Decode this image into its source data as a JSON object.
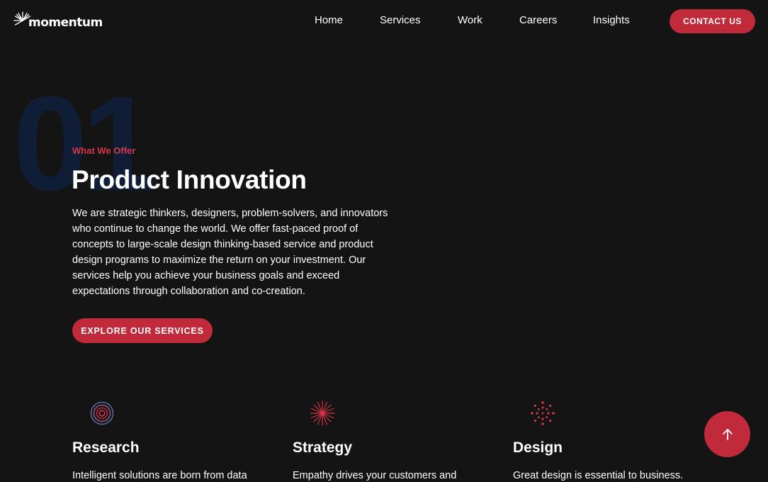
{
  "brand": {
    "name": "momentum",
    "accent": "#c02a3a"
  },
  "nav": {
    "items": [
      {
        "label": "Home"
      },
      {
        "label": "Services"
      },
      {
        "label": "Work"
      },
      {
        "label": "Careers"
      },
      {
        "label": "Insights"
      }
    ],
    "contact_label": "CONTACT US"
  },
  "hero": {
    "number": "01",
    "eyebrow": "What We Offer",
    "title": "Product Innovation",
    "description": "We are strategic thinkers, designers, problem-solvers, and innovators who continue to change the world. We offer fast-paced proof of concepts to large-scale design thinking-based service and product design programs to maximize the return on your investment. Our services help you achieve your business goals and exceed expectations through collaboration and co-creation.",
    "cta_label": "EXPLORE OUR SERVICES"
  },
  "cards": [
    {
      "icon": "concentric-circles-icon",
      "title": "Research",
      "text": "Intelligent solutions are born from data"
    },
    {
      "icon": "starburst-icon",
      "title": "Strategy",
      "text": "Empathy drives your customers and"
    },
    {
      "icon": "dot-burst-icon",
      "title": "Design",
      "text": "Great design is essential to business."
    }
  ],
  "scroll_top": {
    "icon": "arrow-up-icon"
  }
}
